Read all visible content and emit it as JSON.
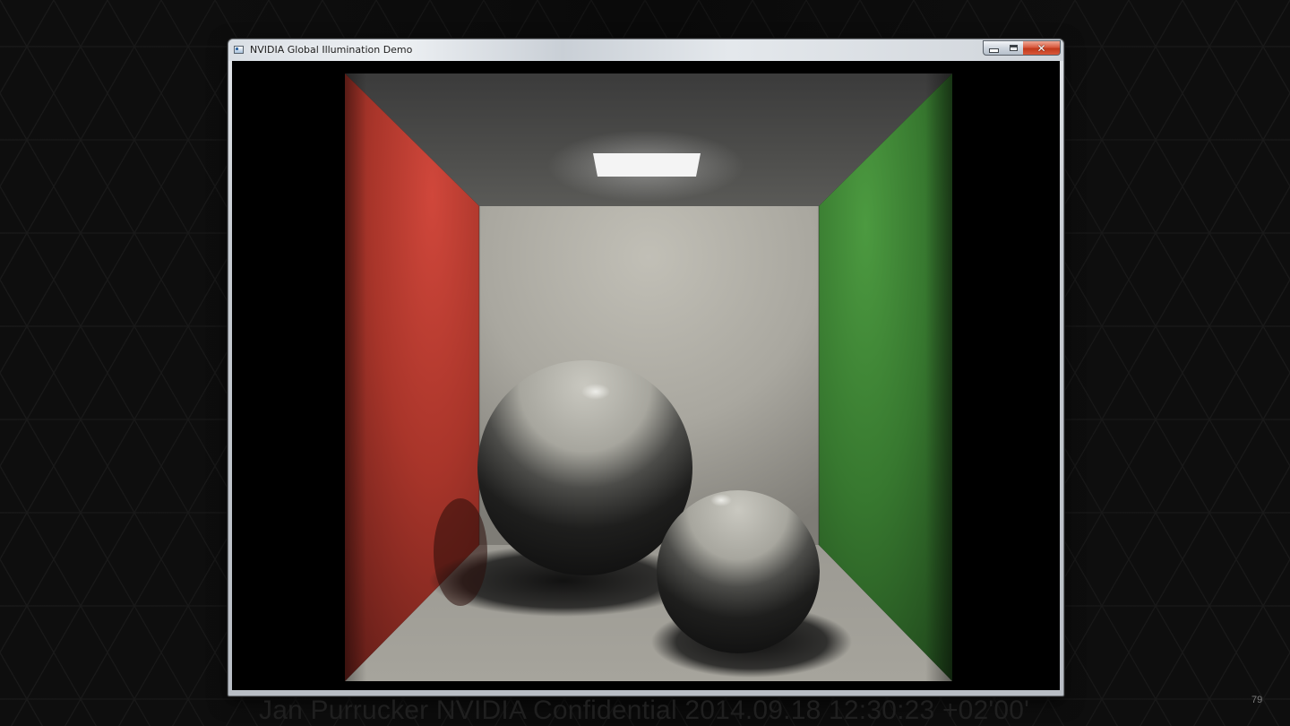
{
  "window": {
    "title": "NVIDIA Global Illumination Demo",
    "icon": "app-window-icon",
    "controls": {
      "minimize_icon": "minimize-icon",
      "maximize_icon": "maximize-icon",
      "close_icon": "close-icon",
      "close_glyph": "✕"
    }
  },
  "scene": {
    "name": "cornell-box",
    "left_wall_color": "#c23a2f",
    "right_wall_color": "#3e8a34",
    "back_wall_color": "#b9b7af",
    "light_color": "#f4f4f4",
    "sphere_color": "#bdbcb4"
  },
  "slide": {
    "footer": "Jan Purrucker NVIDIA Confidential 2014.09.18 12:30:23 +02'00'",
    "page_number": "79"
  },
  "colors": {
    "background": "#0d0d0d",
    "pattern_line": "#1c1c1c"
  }
}
